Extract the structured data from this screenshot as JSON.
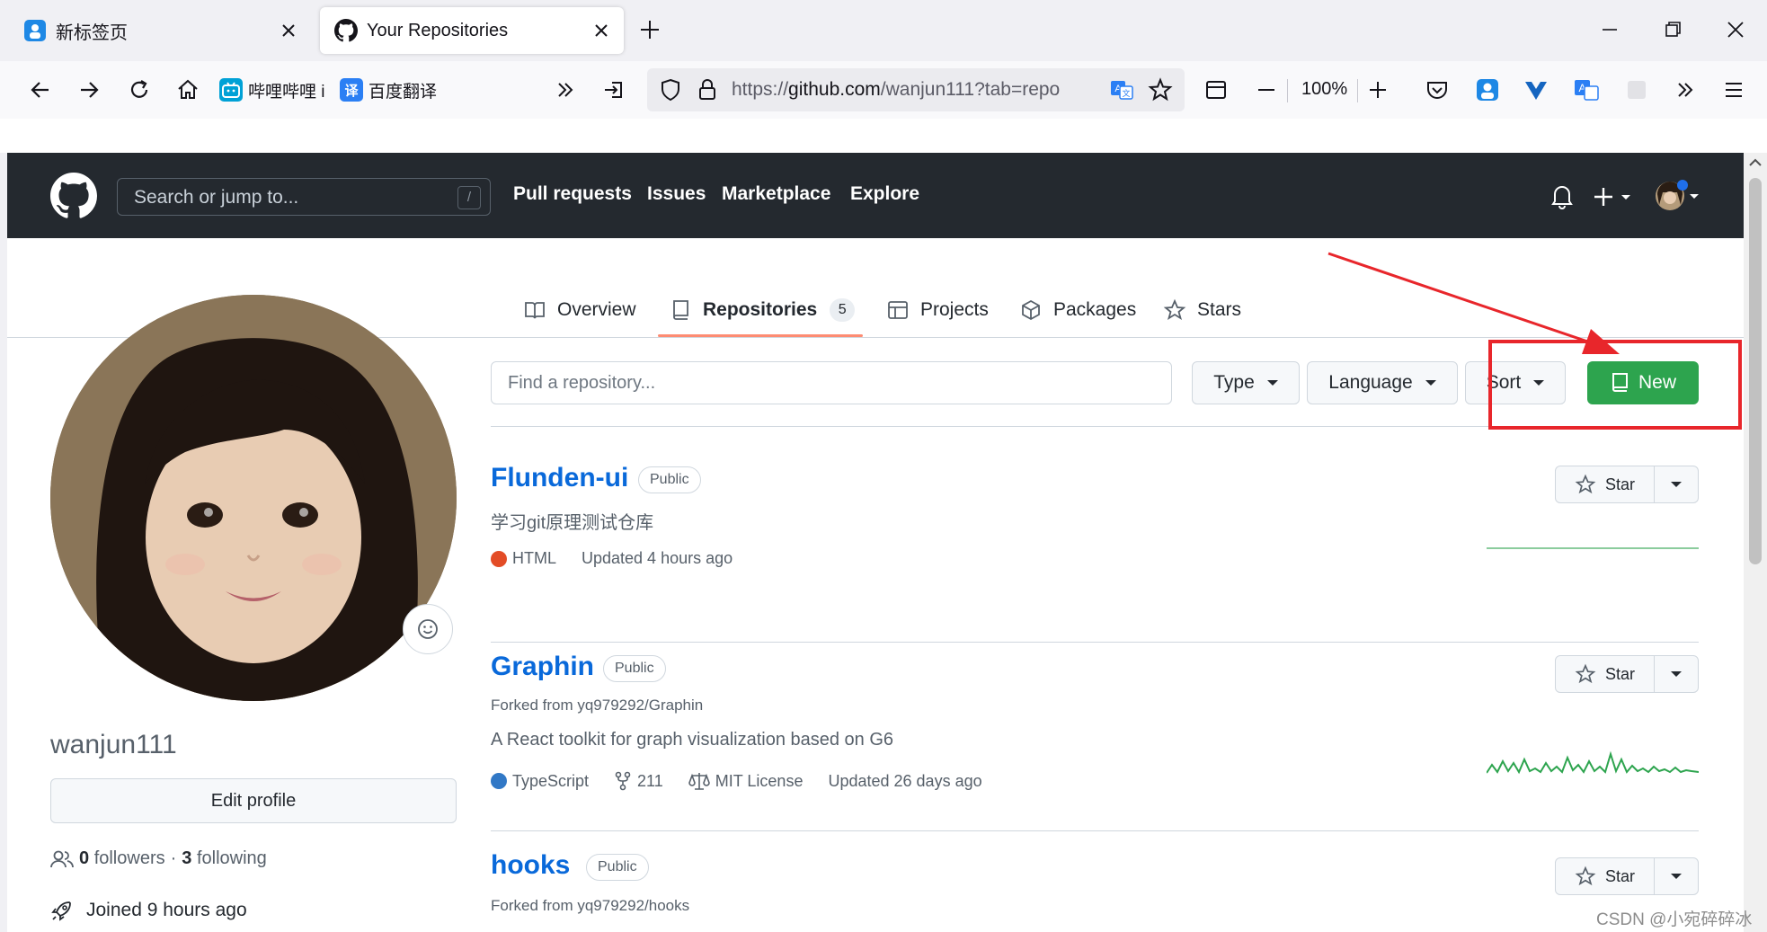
{
  "browser": {
    "tabs": [
      {
        "title": "新标签页",
        "active": false
      },
      {
        "title": "Your Repositories",
        "active": true
      }
    ],
    "bookmarks": [
      {
        "label": "哔哩哔哩 i"
      },
      {
        "label": "百度翻译"
      }
    ],
    "url": {
      "prefix": "https://",
      "host": "github.com",
      "rest": "/wanjun111?tab=repo"
    },
    "zoom": "100%"
  },
  "github": {
    "search_placeholder": "Search or jump to...",
    "search_key": "/",
    "nav": [
      "Pull requests",
      "Issues",
      "Marketplace",
      "Explore"
    ]
  },
  "profile_tabs": [
    {
      "label": "Overview"
    },
    {
      "label": "Repositories",
      "count": "5",
      "active": true
    },
    {
      "label": "Projects"
    },
    {
      "label": "Packages"
    },
    {
      "label": "Stars"
    }
  ],
  "profile": {
    "username": "wanjun111",
    "edit_label": "Edit profile",
    "followers": "0",
    "followers_label": "followers",
    "separator": "·",
    "following": "3",
    "following_label": "following",
    "joined": "Joined 9 hours ago"
  },
  "filters": {
    "find_placeholder": "Find a repository...",
    "type_label": "Type",
    "language_label": "Language",
    "sort_label": "Sort",
    "new_label": "New"
  },
  "repos": [
    {
      "name": "Flunden-ui",
      "visibility": "Public",
      "description": "学习git原理测试仓库",
      "language": "HTML",
      "language_color": "#e34c26",
      "updated": "Updated 4 hours ago",
      "star_label": "Star"
    },
    {
      "name": "Graphin",
      "visibility": "Public",
      "forked_from": "Forked from yq979292/Graphin",
      "description": "A React toolkit for graph visualization based on G6",
      "language": "TypeScript",
      "language_color": "#3178c6",
      "forks": "211",
      "license": "MIT License",
      "updated": "Updated 26 days ago",
      "star_label": "Star"
    },
    {
      "name": "hooks",
      "visibility": "Public",
      "forked_from": "Forked from yq979292/hooks",
      "star_label": "Star"
    }
  ],
  "watermark": "CSDN @小宛碎碎冰",
  "colors": {
    "primary_button": "#2da44e",
    "link": "#0969da",
    "highlight": "#e8262b",
    "header": "#24292f"
  }
}
